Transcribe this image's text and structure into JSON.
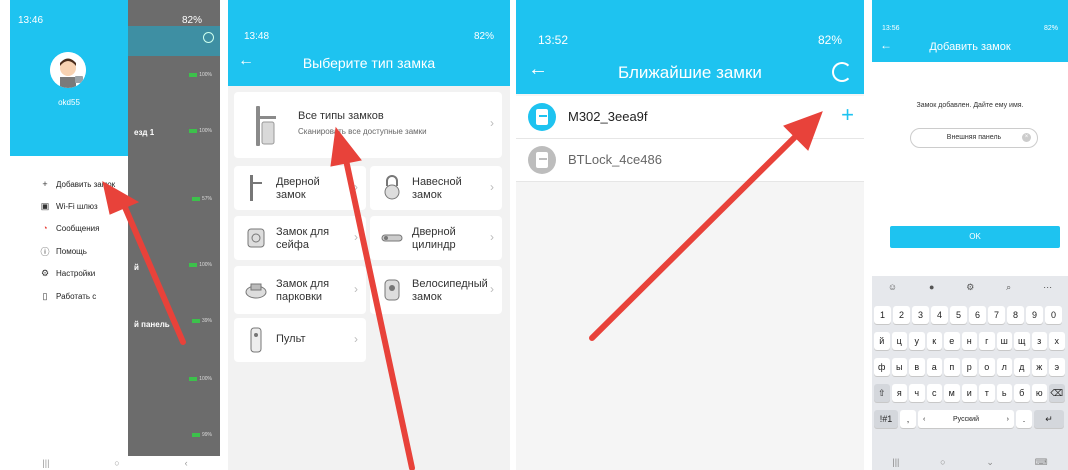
{
  "colors": {
    "primary": "#1ec3f0",
    "arrow": "#e8423a",
    "lock_active": "#1ec3f0",
    "lock_inactive": "#bdbdbd",
    "card_bg": "#ffffff"
  },
  "screen1": {
    "status_time": "13:46",
    "status_right": "82%",
    "username": "okd55",
    "menu": [
      {
        "icon": "plus-icon",
        "glyph": "+",
        "label": "Добавить замок"
      },
      {
        "icon": "wifi-gateway-icon",
        "glyph": "▣",
        "label": "Wi-Fi шлюз"
      },
      {
        "icon": "message-icon",
        "glyph": "◔",
        "label": "Сообщения"
      },
      {
        "icon": "info-icon",
        "glyph": "ⓘ",
        "label": "Помощь"
      },
      {
        "icon": "gear-icon",
        "glyph": "⚙",
        "label": "Настройки"
      },
      {
        "icon": "bookmark-icon",
        "glyph": "▯",
        "label": "Работать с"
      }
    ],
    "background_rows": [
      "езд 1",
      "й",
      "й панель"
    ],
    "battery_labels": [
      "100%",
      "100%",
      "57%",
      "100%",
      "39%",
      "100%",
      "99%"
    ]
  },
  "screen2": {
    "status_time": "13:48",
    "status_right": "82%",
    "title": "Выберите тип замка",
    "all_types": {
      "title": "Все типы замков",
      "subtitle": "Сканировать все доступные замки"
    },
    "types": [
      {
        "icon": "door-lock-icon",
        "label1": "Дверной",
        "label2": "замок"
      },
      {
        "icon": "padlock-icon",
        "label1": "Навесной",
        "label2": "замок"
      },
      {
        "icon": "safe-lock-icon",
        "label1": "Замок для",
        "label2": "сейфа"
      },
      {
        "icon": "door-cylinder-icon",
        "label1": "Дверной",
        "label2": "цилиндр"
      },
      {
        "icon": "parking-lock-icon",
        "label1": "Замок для",
        "label2": "парковки"
      },
      {
        "icon": "bike-lock-icon",
        "label1": "Велосипедный",
        "label2": "замок"
      },
      {
        "icon": "remote-icon",
        "label1": "Пульт",
        "label2": ""
      }
    ]
  },
  "screen3": {
    "status_time": "13:52",
    "status_right": "82%",
    "title": "Ближайшие замки",
    "locks": [
      {
        "name": "M302_3eea9f",
        "action": "+",
        "active": true
      },
      {
        "name": "BTLock_4ce486",
        "action": "",
        "active": false
      }
    ]
  },
  "screen4": {
    "status_time": "13:56",
    "status_right": "82%",
    "title": "Добавить замок",
    "message": "Замок добавлен. Дайте ему имя.",
    "input_value": "Внешняя панель",
    "ok_label": "OK",
    "keyboard": {
      "toolbar": [
        "☺",
        "🎤",
        "⚙",
        "🔍",
        "⋯"
      ],
      "row_digits": [
        "1",
        "2",
        "3",
        "4",
        "5",
        "6",
        "7",
        "8",
        "9",
        "0"
      ],
      "row1": [
        "й",
        "ц",
        "у",
        "к",
        "е",
        "н",
        "г",
        "ш",
        "щ",
        "з",
        "х"
      ],
      "row2": [
        "ф",
        "ы",
        "в",
        "а",
        "п",
        "р",
        "о",
        "л",
        "д",
        "ж",
        "э"
      ],
      "row3": [
        "я",
        "ч",
        "с",
        "м",
        "и",
        "т",
        "ь",
        "б",
        "ю"
      ],
      "sym_label": "!#1",
      "space_label": "Русский",
      "comma": ",",
      "period": "."
    }
  }
}
